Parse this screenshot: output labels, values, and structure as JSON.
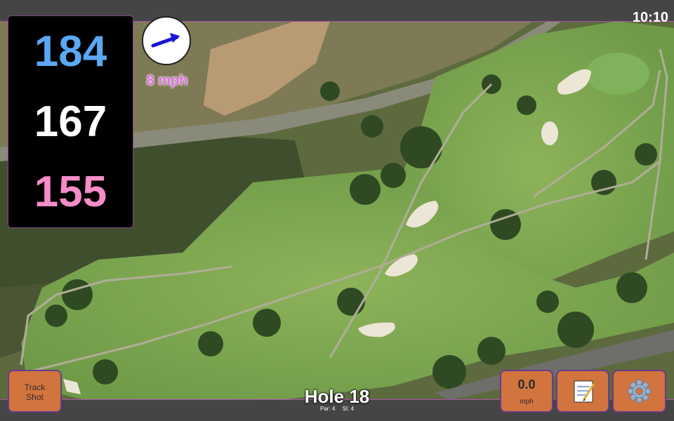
{
  "status": {
    "time": "10:10"
  },
  "distances": {
    "back": "184",
    "middle": "167",
    "front": "155"
  },
  "wind": {
    "speed_label": "8 mph",
    "icon": "arrow-icon"
  },
  "hole": {
    "title": "Hole 18",
    "par": "Par: 4",
    "si": "SI: 4"
  },
  "buttons": {
    "track_shot": {
      "line1": "Track",
      "line2": "Shot"
    },
    "speed": {
      "value": "0.0",
      "unit": "mph"
    },
    "notes_icon": "notepad-icon",
    "settings_icon": "gear-icon"
  },
  "colors": {
    "back": "#5ba8f5",
    "middle": "#ffffff",
    "front": "#f58cc8",
    "button": "#d2743e",
    "wind_text": "#e070e0"
  }
}
